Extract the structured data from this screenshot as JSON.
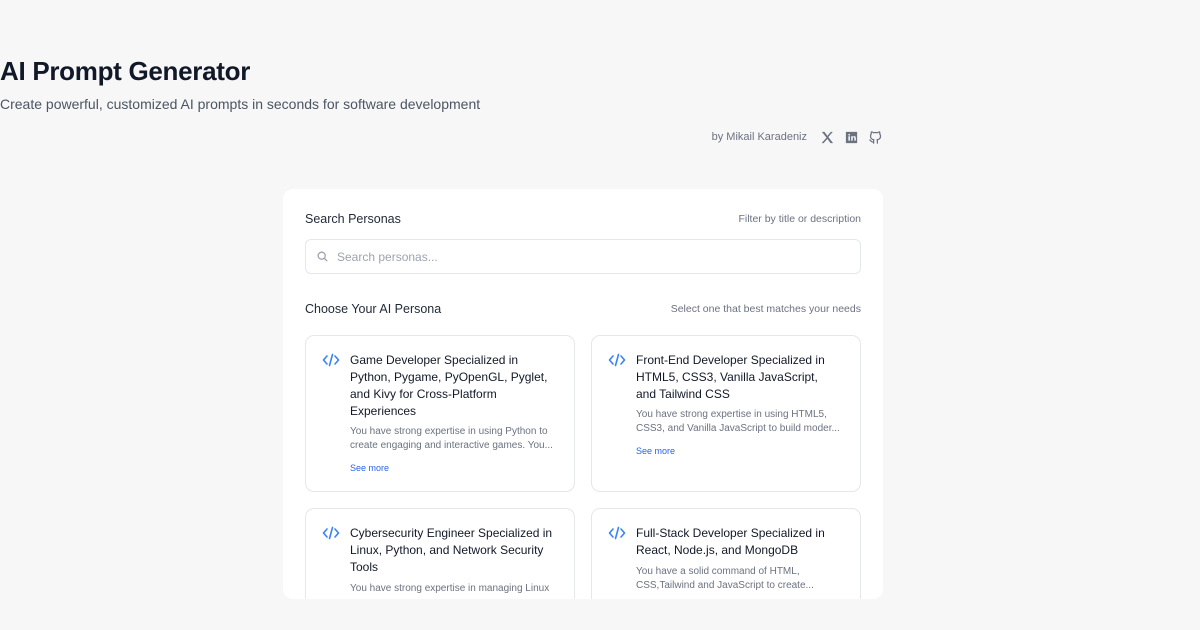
{
  "header": {
    "title": "AI Prompt Generator",
    "subtitle": "Create powerful, customized AI prompts in seconds for software development",
    "byline": "by Mikail Karadeniz",
    "social": [
      "x-icon",
      "linkedin-icon",
      "github-icon"
    ]
  },
  "search": {
    "label": "Search Personas",
    "hint": "Filter by title or description",
    "placeholder": "Search personas..."
  },
  "personas": {
    "label": "Choose Your AI Persona",
    "hint": "Select one that best matches your needs",
    "see_more": "See more",
    "items": [
      {
        "title": "Game Developer Specialized in Python, Pygame, PyOpenGL, Pyglet, and Kivy for Cross-Platform Experiences",
        "description": "You have strong expertise in using Python to create engaging and interactive games. You..."
      },
      {
        "title": "Front-End Developer Specialized in HTML5, CSS3, Vanilla JavaScript, and Tailwind CSS",
        "description": "You have strong expertise in using HTML5, CSS3, and Vanilla JavaScript to build moder..."
      },
      {
        "title": "Cybersecurity Engineer Specialized in Linux, Python, and Network Security Tools",
        "description": "You have strong expertise in managing Linux"
      },
      {
        "title": "Full-Stack Developer Specialized in React, Node.js, and MongoDB",
        "description": "You have a solid command of HTML, CSS,Tailwind and JavaScript to create..."
      }
    ]
  },
  "colors": {
    "accent": "#3b82f6",
    "link": "#2563eb",
    "background": "#f7f7f8"
  }
}
